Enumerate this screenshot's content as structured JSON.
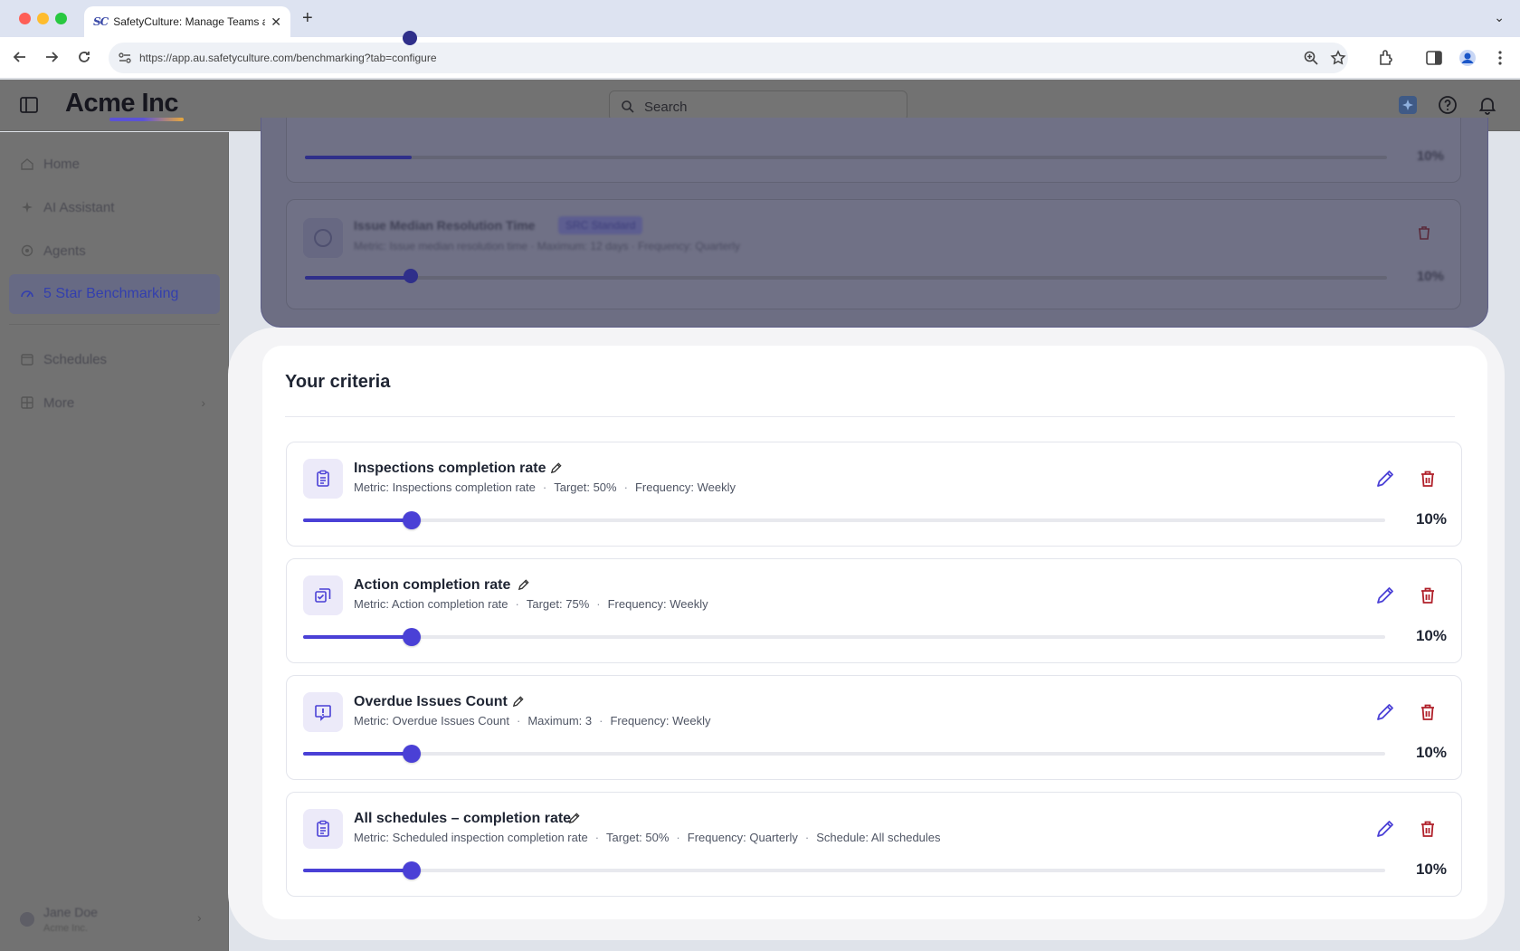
{
  "browser": {
    "tab_favicon": "SC",
    "tab_title": "SafetyCulture: Manage Teams and...",
    "url": "https://app.au.safetyculture.com/benchmarking?tab=configure"
  },
  "header": {
    "logo": "Acme Inc",
    "search_placeholder": "Search"
  },
  "sidebar": {
    "items": [
      {
        "label": "Home",
        "icon": "home-icon"
      },
      {
        "label": "AI Assistant",
        "icon": "sparkle-icon"
      },
      {
        "label": "Agents",
        "icon": "agents-icon"
      },
      {
        "label": "5 Star Benchmarking",
        "icon": "benchmark-gauge-icon",
        "active": true
      },
      {
        "label": "Schedules",
        "icon": "calendar-icon"
      },
      {
        "label": "More",
        "icon": "grid-icon"
      }
    ],
    "user": {
      "name": "Jane Doe",
      "org": "Acme Inc."
    }
  },
  "background": {
    "card_partial_pct": "10%",
    "card2": {
      "title": "Issue Median Resolution Time",
      "badge": "SRC Standard",
      "meta": "Metric: Issue median resolution time · Maximum: 12 days · Frequency: Quarterly",
      "pct": "10%"
    }
  },
  "criteria": {
    "title": "Your criteria",
    "cards": [
      {
        "title": "Inspections completion rate",
        "icon": "clipboard-icon",
        "meta": [
          "Metric: Inspections completion rate",
          "Target: 50%",
          "Frequency: Weekly"
        ],
        "weight": 0.1,
        "weight_label": "10%"
      },
      {
        "title": "Action completion rate",
        "icon": "action-check-icon",
        "meta": [
          "Metric: Action completion rate",
          "Target: 75%",
          "Frequency: Weekly"
        ],
        "weight": 0.1,
        "weight_label": "10%"
      },
      {
        "title": "Overdue Issues Count",
        "icon": "issue-alert-icon",
        "meta": [
          "Metric: Overdue Issues Count",
          "Maximum: 3",
          "Frequency: Weekly"
        ],
        "weight": 0.1,
        "weight_label": "10%"
      },
      {
        "title": "All schedules – completion rate",
        "icon": "clipboard-icon",
        "meta": [
          "Metric: Scheduled inspection completion rate",
          "Target: 50%",
          "Frequency: Quarterly",
          "Schedule: All schedules"
        ],
        "weight": 0.1,
        "weight_label": "10%"
      }
    ]
  },
  "colors": {
    "accent": "#4a40d6",
    "delete": "#b0202a",
    "dim_overlay": "#727272"
  }
}
